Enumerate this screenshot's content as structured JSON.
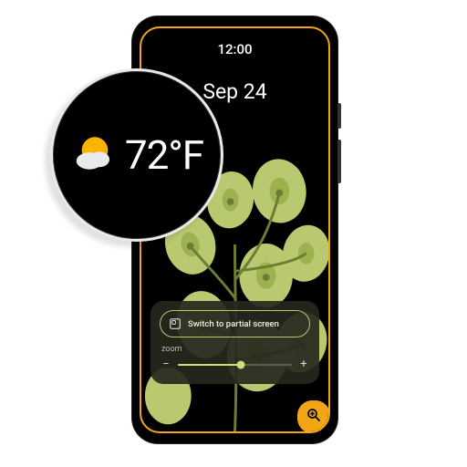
{
  "status": {
    "time": "12:00"
  },
  "lockscreen": {
    "date": "Sep 24"
  },
  "magnifier": {
    "panel": {
      "switch_label": "Switch to partial screen",
      "zoom_label": "zoom",
      "minus": "−",
      "plus": "+",
      "zoom_percent": 55
    }
  },
  "weather_bubble": {
    "temp": "72°F"
  },
  "colors": {
    "accent": "#f2a515",
    "lime": "#cbe176"
  }
}
